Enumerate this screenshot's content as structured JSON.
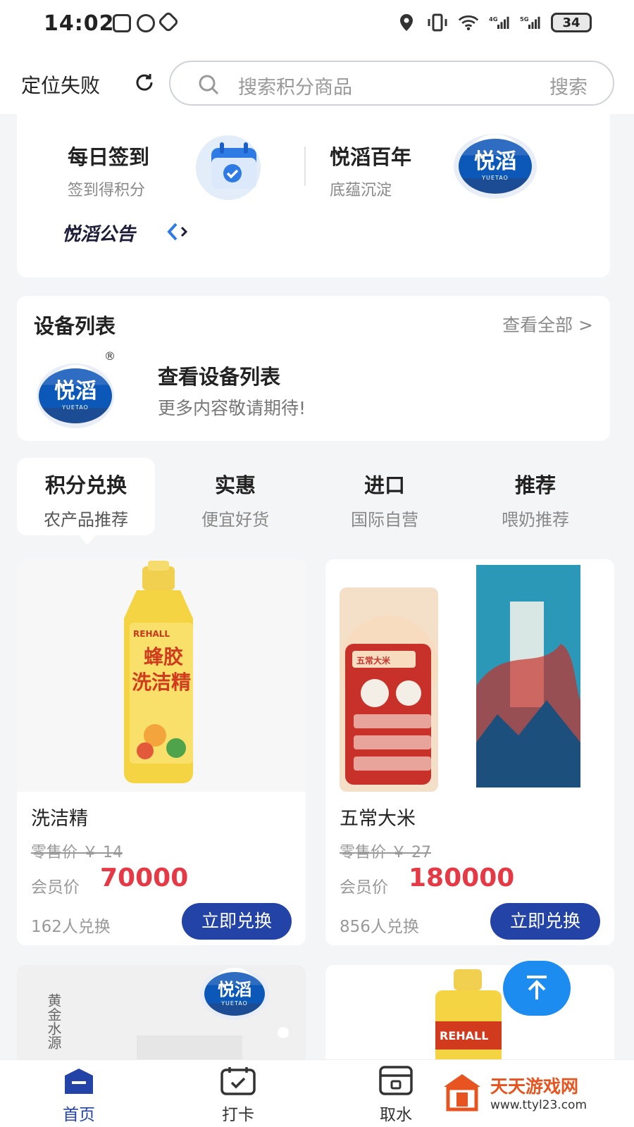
{
  "status_bar": {
    "time": "14:02",
    "battery": "34",
    "net_4g": "4G",
    "net_5g": "5G"
  },
  "header": {
    "location": "定位失败",
    "search_placeholder": "搜索积分商品",
    "search_button": "搜索"
  },
  "features": [
    {
      "title": "每日签到",
      "subtitle": "签到得积分",
      "icon": "calendar-check-icon"
    },
    {
      "title": "悦滔百年",
      "subtitle": "底蕴沉淀",
      "icon": "yuetao-logo"
    }
  ],
  "notice": {
    "label": "悦滔公告"
  },
  "brand": {
    "logo_text": "悦滔",
    "logo_en": "YUETAO",
    "registered": "®"
  },
  "device": {
    "title": "设备列表",
    "view_all": "查看全部 >",
    "main": "查看设备列表",
    "sub": "更多内容敬请期待!"
  },
  "tabs": [
    {
      "title": "积分兑换",
      "subtitle": "农产品推荐",
      "active": true
    },
    {
      "title": "实惠",
      "subtitle": "便宜好货",
      "active": false
    },
    {
      "title": "进口",
      "subtitle": "国际自营",
      "active": false
    },
    {
      "title": "推荐",
      "subtitle": "喂奶推荐",
      "active": false
    }
  ],
  "products": [
    {
      "name": "洗洁精",
      "retail": "零售价 ￥ 14",
      "member_label": "会员价",
      "member_price": "70000",
      "count": "162人兑换",
      "button": "立即兑换",
      "image_text_1": "蜂胶",
      "image_text_2": "洗洁精",
      "image_brand": "REHALL"
    },
    {
      "name": "五常大米",
      "retail": "零售价 ￥ 27",
      "member_label": "会员价",
      "member_price": "180000",
      "count": "856人兑换",
      "button": "立即兑换",
      "image_text_1": "五常大米"
    }
  ],
  "partial_products": [
    {
      "image_text": "黄金水源"
    },
    {
      "image_text": "REHALL"
    }
  ],
  "bottom_nav": [
    {
      "label": "首页",
      "icon": "home-icon",
      "active": true
    },
    {
      "label": "打卡",
      "icon": "calendar-check-icon",
      "active": false
    },
    {
      "label": "取水",
      "icon": "water-dispenser-icon",
      "active": false
    }
  ],
  "watermark": {
    "name": "天天游戏网",
    "url": "www.ttyl23.com"
  },
  "colors": {
    "accent": "#2443a6",
    "price": "#e53a45",
    "top_button": "#1d8cf0"
  }
}
